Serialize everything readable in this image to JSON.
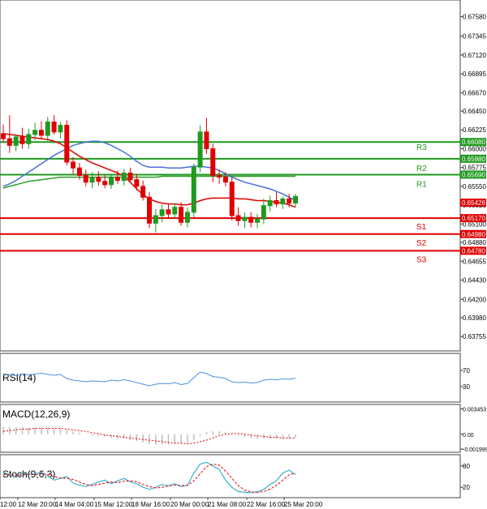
{
  "colors": {
    "resistance": "#1f9a1f",
    "support": "#e00000",
    "bull": "#1f9a1f",
    "bear": "#e00000",
    "ma_fast": "#e00000",
    "ma_slow": "#4a6fd8",
    "ma_green": "#2e9e2e",
    "rsi": "#4a90e2",
    "macd_hist": "#bfbfbf",
    "macd_signal": "#e00000",
    "stoch_k": "#3ab0c8",
    "stoch_d": "#e00000",
    "price_tag": "#e00000"
  },
  "main": {
    "y_ticks": [
      "0.67580",
      "0.67345",
      "0.67120",
      "0.66895",
      "0.66670",
      "0.66450",
      "0.66225",
      "0.66000",
      "0.65775",
      "0.65550",
      "0.65325",
      "0.65100",
      "0.64880",
      "0.64655",
      "0.64430",
      "0.64200",
      "0.63980",
      "0.63755"
    ],
    "current_price": "0.65426",
    "levels": [
      {
        "name": "R3",
        "value": "0.66080",
        "type": "resistance"
      },
      {
        "name": "",
        "value": "0.65880",
        "type": "resistance"
      },
      {
        "name": "R2",
        "value": "",
        "type": "resistance"
      },
      {
        "name": "",
        "value": "0.65690",
        "type": "resistance"
      },
      {
        "name": "R1",
        "value": "",
        "type": "resistance"
      },
      {
        "name": "S1",
        "value": "0.65170",
        "type": "support"
      },
      {
        "name": "S2",
        "value": "0.64980",
        "type": "support"
      },
      {
        "name": "S3",
        "value": "0.64780",
        "type": "support"
      }
    ]
  },
  "rsi": {
    "title": "RSI(14)",
    "ticks": [
      "70",
      "30"
    ]
  },
  "macd": {
    "title": "MACD(12,26,9)",
    "ticks": [
      "0.003453",
      "0.00",
      "-0.001999"
    ]
  },
  "stoch": {
    "title": "Stoch(9,6,3)",
    "ticks": [
      "80",
      "20"
    ]
  },
  "x_ticks": [
    "12:00",
    "12 Mar 20:00",
    "14 Mar 04:00",
    "15 Mar 12:00",
    "18 Mar 16:00",
    "20 Mar 00:00",
    "21 Mar 08:00",
    "22 Mar 16:00",
    "25 Mar 20:00"
  ],
  "chart_data": {
    "type": "candlestick",
    "instrument_panel": "price",
    "y_range": [
      0.6366,
      0.677
    ],
    "candles": [
      {
        "o": 0.6618,
        "h": 0.6629,
        "l": 0.6608,
        "c": 0.6612
      },
      {
        "o": 0.6612,
        "h": 0.664,
        "l": 0.6595,
        "c": 0.6604
      },
      {
        "o": 0.6604,
        "h": 0.6617,
        "l": 0.6597,
        "c": 0.6614
      },
      {
        "o": 0.6614,
        "h": 0.6625,
        "l": 0.66,
        "c": 0.6606
      },
      {
        "o": 0.6606,
        "h": 0.6624,
        "l": 0.66,
        "c": 0.6617
      },
      {
        "o": 0.6617,
        "h": 0.6631,
        "l": 0.661,
        "c": 0.6622
      },
      {
        "o": 0.6622,
        "h": 0.6633,
        "l": 0.6612,
        "c": 0.6616
      },
      {
        "o": 0.6616,
        "h": 0.6638,
        "l": 0.6609,
        "c": 0.6632
      },
      {
        "o": 0.6632,
        "h": 0.664,
        "l": 0.6617,
        "c": 0.662
      },
      {
        "o": 0.662,
        "h": 0.6632,
        "l": 0.6612,
        "c": 0.6628
      },
      {
        "o": 0.6628,
        "h": 0.6634,
        "l": 0.658,
        "c": 0.6584
      },
      {
        "o": 0.6584,
        "h": 0.659,
        "l": 0.657,
        "c": 0.6577
      },
      {
        "o": 0.6577,
        "h": 0.6583,
        "l": 0.6563,
        "c": 0.6568
      },
      {
        "o": 0.6568,
        "h": 0.6575,
        "l": 0.6555,
        "c": 0.656
      },
      {
        "o": 0.656,
        "h": 0.6572,
        "l": 0.6553,
        "c": 0.6566
      },
      {
        "o": 0.6566,
        "h": 0.6573,
        "l": 0.6556,
        "c": 0.6561
      },
      {
        "o": 0.6561,
        "h": 0.6568,
        "l": 0.6553,
        "c": 0.6557
      },
      {
        "o": 0.6557,
        "h": 0.657,
        "l": 0.6552,
        "c": 0.6566
      },
      {
        "o": 0.6566,
        "h": 0.6574,
        "l": 0.6558,
        "c": 0.6562
      },
      {
        "o": 0.6562,
        "h": 0.6576,
        "l": 0.6556,
        "c": 0.6571
      },
      {
        "o": 0.6571,
        "h": 0.6577,
        "l": 0.656,
        "c": 0.6563
      },
      {
        "o": 0.6563,
        "h": 0.657,
        "l": 0.655,
        "c": 0.6555
      },
      {
        "o": 0.6555,
        "h": 0.6562,
        "l": 0.6538,
        "c": 0.6542
      },
      {
        "o": 0.6542,
        "h": 0.6548,
        "l": 0.6505,
        "c": 0.6511
      },
      {
        "o": 0.6511,
        "h": 0.6528,
        "l": 0.65,
        "c": 0.652
      },
      {
        "o": 0.652,
        "h": 0.6533,
        "l": 0.6512,
        "c": 0.6527
      },
      {
        "o": 0.6527,
        "h": 0.6534,
        "l": 0.6517,
        "c": 0.6522
      },
      {
        "o": 0.6522,
        "h": 0.6535,
        "l": 0.6516,
        "c": 0.653
      },
      {
        "o": 0.653,
        "h": 0.6536,
        "l": 0.6508,
        "c": 0.6512
      },
      {
        "o": 0.6512,
        "h": 0.653,
        "l": 0.6506,
        "c": 0.6524
      },
      {
        "o": 0.6524,
        "h": 0.6582,
        "l": 0.6518,
        "c": 0.6578
      },
      {
        "o": 0.6578,
        "h": 0.6628,
        "l": 0.6572,
        "c": 0.662
      },
      {
        "o": 0.662,
        "h": 0.6637,
        "l": 0.6594,
        "c": 0.66
      },
      {
        "o": 0.66,
        "h": 0.6606,
        "l": 0.656,
        "c": 0.6568
      },
      {
        "o": 0.6568,
        "h": 0.6575,
        "l": 0.6558,
        "c": 0.6566
      },
      {
        "o": 0.6566,
        "h": 0.6572,
        "l": 0.6555,
        "c": 0.656
      },
      {
        "o": 0.656,
        "h": 0.6566,
        "l": 0.6514,
        "c": 0.652
      },
      {
        "o": 0.652,
        "h": 0.653,
        "l": 0.6508,
        "c": 0.6514
      },
      {
        "o": 0.6514,
        "h": 0.6524,
        "l": 0.6505,
        "c": 0.6518
      },
      {
        "o": 0.6518,
        "h": 0.6524,
        "l": 0.6506,
        "c": 0.6512
      },
      {
        "o": 0.6512,
        "h": 0.6522,
        "l": 0.6505,
        "c": 0.6516
      },
      {
        "o": 0.6516,
        "h": 0.654,
        "l": 0.651,
        "c": 0.6532
      },
      {
        "o": 0.6532,
        "h": 0.6544,
        "l": 0.6525,
        "c": 0.6538
      },
      {
        "o": 0.6538,
        "h": 0.6548,
        "l": 0.653,
        "c": 0.6534
      },
      {
        "o": 0.6534,
        "h": 0.6543,
        "l": 0.6528,
        "c": 0.654
      },
      {
        "o": 0.654,
        "h": 0.6546,
        "l": 0.653,
        "c": 0.6535
      },
      {
        "o": 0.6535,
        "h": 0.6546,
        "l": 0.653,
        "c": 0.6543
      }
    ],
    "ma_fast": [
      0.6618,
      0.6617,
      0.6616,
      0.6615,
      0.6614,
      0.6613,
      0.6612,
      0.6611,
      0.6609,
      0.6606,
      0.6601,
      0.6596,
      0.6591,
      0.6587,
      0.6583,
      0.658,
      0.6577,
      0.6574,
      0.6571,
      0.6567,
      0.656,
      0.6552,
      0.6545,
      0.654,
      0.6537,
      0.6535,
      0.6534,
      0.6534,
      0.6533,
      0.6533,
      0.6535,
      0.6538,
      0.654,
      0.6541,
      0.6541,
      0.6541,
      0.6541,
      0.654,
      0.654,
      0.6539,
      0.6538,
      0.6538,
      0.6537,
      0.6536,
      0.6535,
      0.6533,
      0.653
    ],
    "ma_slow": [
      0.6555,
      0.6558,
      0.6562,
      0.6567,
      0.6572,
      0.6577,
      0.6582,
      0.6587,
      0.6592,
      0.6596,
      0.66,
      0.6604,
      0.6606,
      0.6608,
      0.6609,
      0.6609,
      0.6607,
      0.6604,
      0.66,
      0.6596,
      0.6591,
      0.6585,
      0.658,
      0.6578,
      0.6578,
      0.6578,
      0.6577,
      0.6577,
      0.6577,
      0.6578,
      0.6579,
      0.6579,
      0.6578,
      0.6577,
      0.6574,
      0.657,
      0.6566,
      0.6563,
      0.656,
      0.6558,
      0.6556,
      0.6554,
      0.6552,
      0.6549,
      0.6546,
      0.6542,
      0.6538
    ],
    "ma_green": [
      0.6553,
      0.6555,
      0.6557,
      0.6559,
      0.6561,
      0.6562,
      0.6563,
      0.6564,
      0.6565,
      0.6566,
      0.6566,
      0.6566,
      0.6566,
      0.6566,
      0.6566,
      0.6566,
      0.6566,
      0.6566,
      0.6566,
      0.6566,
      0.6566,
      0.6566,
      0.6566,
      0.6566,
      0.6566,
      0.6567,
      0.6567,
      0.6567,
      0.6567,
      0.6567,
      0.6567,
      0.6567,
      0.6567,
      0.6567,
      0.6567,
      0.6567,
      0.6567,
      0.6567,
      0.6567,
      0.6567,
      0.6567,
      0.6567,
      0.6567,
      0.6567,
      0.6567,
      0.6567,
      0.6567
    ],
    "rsi": {
      "range": [
        0,
        100
      ],
      "values": [
        58,
        60,
        57,
        62,
        59,
        61,
        63,
        60,
        58,
        60,
        50,
        46,
        44,
        42,
        44,
        43,
        42,
        46,
        44,
        47,
        44,
        40,
        36,
        32,
        36,
        38,
        37,
        40,
        35,
        38,
        52,
        66,
        62,
        55,
        53,
        50,
        42,
        40,
        41,
        39,
        40,
        46,
        48,
        47,
        49,
        48,
        51
      ]
    },
    "macd": {
      "range": [
        -0.002,
        0.0035
      ],
      "hist": [
        0.001,
        0.001,
        0.001,
        0.001,
        0.0009,
        0.0009,
        0.0009,
        0.0009,
        0.0008,
        0.0008,
        0.0006,
        0.0004,
        0.0002,
        0.0,
        -0.0002,
        -0.0003,
        -0.0004,
        -0.0005,
        -0.0006,
        -0.0006,
        -0.0008,
        -0.0009,
        -0.0011,
        -0.0013,
        -0.0014,
        -0.0014,
        -0.0014,
        -0.0013,
        -0.0013,
        -0.0012,
        -0.0008,
        -0.0002,
        0.0003,
        0.0004,
        0.0004,
        0.0003,
        0.0001,
        -0.0002,
        -0.0004,
        -0.0005,
        -0.0006,
        -0.0006,
        -0.0006,
        -0.0006,
        -0.0006,
        -0.0006,
        -0.0005
      ],
      "signal": [
        0.0004,
        0.0005,
        0.0006,
        0.0007,
        0.0007,
        0.0008,
        0.0008,
        0.0008,
        0.0008,
        0.0008,
        0.0007,
        0.0006,
        0.0005,
        0.0004,
        0.0002,
        0.0001,
        -0.0001,
        -0.0002,
        -0.0003,
        -0.0004,
        -0.0005,
        -0.0006,
        -0.0007,
        -0.0008,
        -0.0009,
        -0.001,
        -0.0011,
        -0.0012,
        -0.0012,
        -0.0013,
        -0.0012,
        -0.001,
        -0.0008,
        -0.0005,
        -0.0002,
        0.0,
        0.0001,
        0.0001,
        0.0,
        -0.0001,
        -0.0002,
        -0.0003,
        -0.0004,
        -0.0004,
        -0.0005,
        -0.0005,
        -0.0005
      ]
    },
    "stoch": {
      "range": [
        0,
        100
      ],
      "k": [
        62,
        55,
        48,
        60,
        55,
        58,
        62,
        52,
        40,
        45,
        50,
        32,
        26,
        22,
        28,
        35,
        40,
        30,
        38,
        45,
        35,
        30,
        20,
        14,
        20,
        28,
        24,
        30,
        22,
        26,
        60,
        85,
        90,
        80,
        70,
        40,
        20,
        8,
        6,
        5,
        7,
        14,
        28,
        38,
        60,
        68,
        55
      ],
      "d": [
        55,
        56,
        52,
        55,
        57,
        55,
        58,
        56,
        50,
        46,
        45,
        42,
        35,
        28,
        25,
        28,
        32,
        35,
        33,
        37,
        38,
        36,
        28,
        22,
        18,
        20,
        24,
        26,
        25,
        25,
        38,
        58,
        78,
        85,
        82,
        65,
        45,
        25,
        12,
        7,
        6,
        8,
        15,
        25,
        40,
        55,
        60
      ]
    }
  }
}
